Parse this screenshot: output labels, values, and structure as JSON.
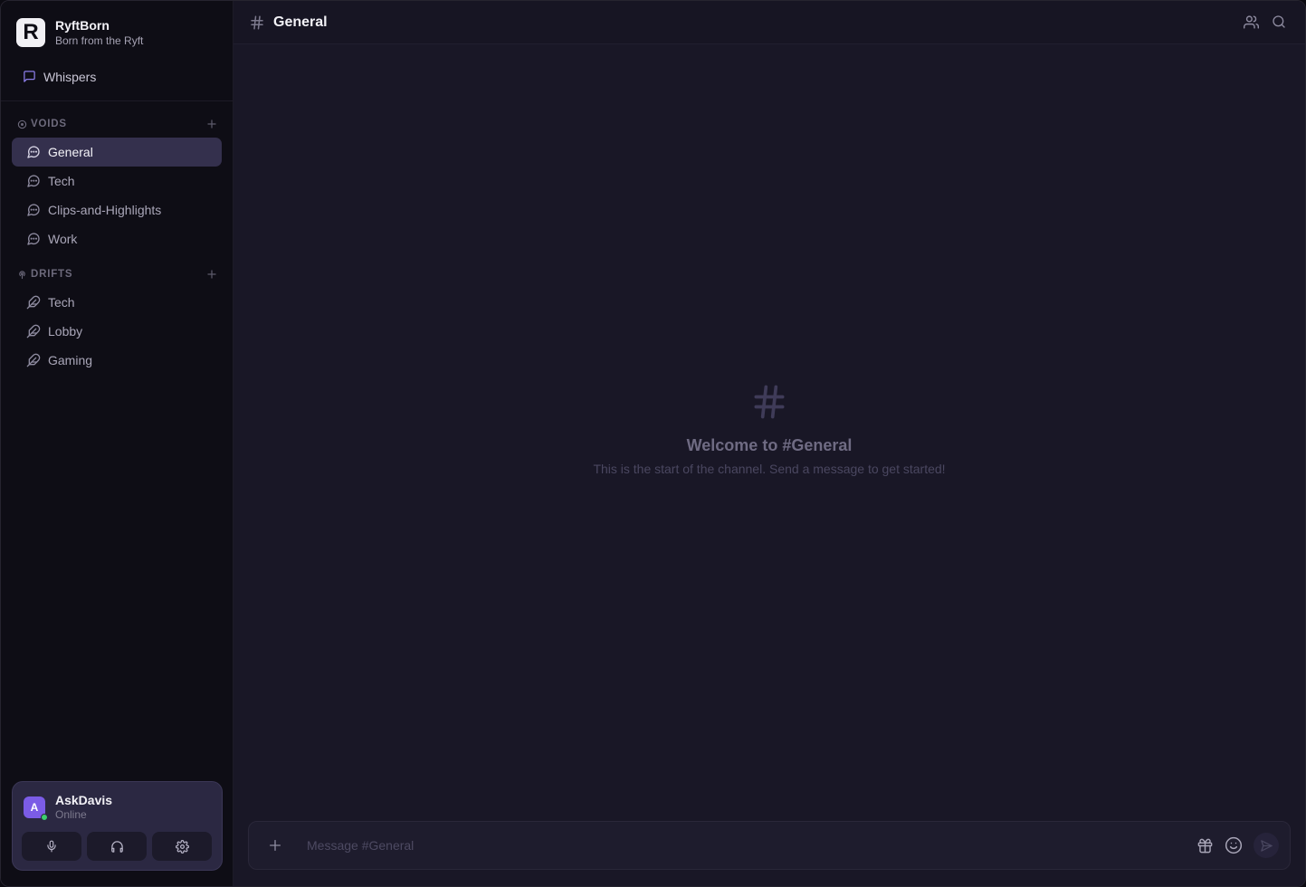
{
  "app": {
    "name": "RyftBorn",
    "tagline": "Born from the Ryft",
    "logo_letter": "R"
  },
  "whispers": {
    "label": "Whispers",
    "icon": "message-square-icon"
  },
  "voids": {
    "title": "VOIDS",
    "items": [
      {
        "label": "General",
        "active": true
      },
      {
        "label": "Tech"
      },
      {
        "label": "Clips-and-Highlights"
      },
      {
        "label": "Work"
      }
    ]
  },
  "drifts": {
    "title": "DRIFTS",
    "items": [
      {
        "label": "Tech"
      },
      {
        "label": "Lobby"
      },
      {
        "label": "Gaming"
      }
    ]
  },
  "user": {
    "initial": "A",
    "name": "AskDavis",
    "status": "Online"
  },
  "channel": {
    "title": "General"
  },
  "welcome": {
    "title": "Welcome to #General",
    "subtitle": "This is the start of the channel. Send a message to get started!"
  },
  "composer": {
    "placeholder": "Message #General"
  },
  "colors": {
    "accent": "#7b5ce6",
    "active_item_bg": "#34304d",
    "online": "#3ccf6e",
    "sidebar_bg": "#0e0d15",
    "main_bg": "#191726"
  }
}
